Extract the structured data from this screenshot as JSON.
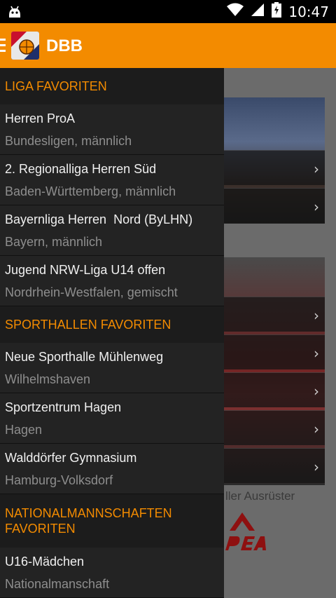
{
  "status_bar": {
    "time": "10:47"
  },
  "app_bar": {
    "title": "DBB"
  },
  "background": {
    "outfitter_text": "ller Ausrüster",
    "chevron": "›"
  },
  "drawer": {
    "sections": [
      {
        "header": "LIGA FAVORITEN",
        "items": [
          {
            "title": "Herren ProA",
            "subtitle": "Bundesligen, männlich"
          },
          {
            "title": "2. Regionalliga Herren Süd",
            "subtitle": "Baden-Württemberg, männlich"
          },
          {
            "title": "Bayernliga Herren  Nord (ByLHN)",
            "subtitle": "Bayern, männlich"
          },
          {
            "title": "Jugend NRW-Liga U14 offen",
            "subtitle": "Nordrhein-Westfalen, gemischt"
          }
        ]
      },
      {
        "header": "SPORTHALLEN FAVORITEN",
        "items": [
          {
            "title": "Neue Sporthalle Mühlenweg",
            "subtitle": "Wilhelmshaven"
          },
          {
            "title": "Sportzentrum Hagen",
            "subtitle": "Hagen"
          },
          {
            "title": "Walddörfer Gymnasium",
            "subtitle": "Hamburg-Volksdorf"
          }
        ]
      },
      {
        "header_line1": "NATIONALMANNSCHAFTEN",
        "header_line2": "FAVORITEN",
        "items": [
          {
            "title": "U16-Mädchen",
            "subtitle": "Nationalmanschaft"
          }
        ]
      }
    ]
  },
  "colors": {
    "accent": "#f38b00",
    "drawer_bg": "#232323"
  },
  "icons": [
    "android-debug-icon",
    "wifi-icon",
    "signal-icon",
    "battery-charging-icon",
    "menu-icon",
    "dbb-logo-icon",
    "chevron-right-icon"
  ]
}
